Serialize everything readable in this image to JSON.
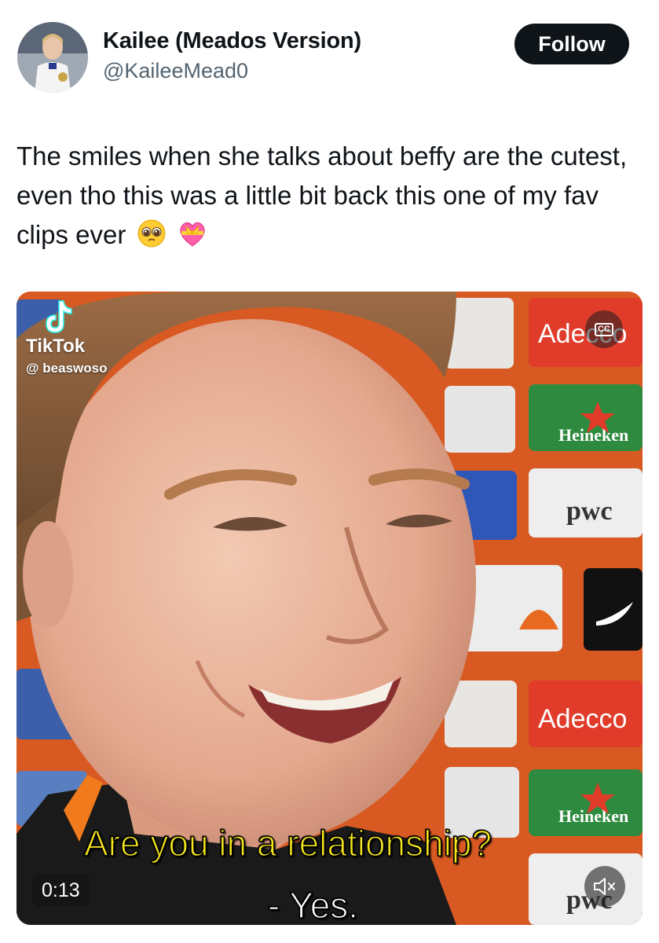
{
  "author": {
    "display_name": "Kailee (Meados Version)",
    "handle": "@KaileeMead0",
    "avatar_icon": "profile-avatar"
  },
  "follow_label": "Follow",
  "tweet": {
    "text": "The smiles when she talks about beffy are the cutest, even tho this was a little bit back this one of my fav clips ever",
    "emojis": [
      "pleading-face-emoji",
      "heart-with-ribbon-emoji"
    ]
  },
  "video": {
    "watermark_app": "TikTok",
    "watermark_user": "@ beaswoso",
    "caption_line1": "Are you in a relationship?",
    "caption_line2": "- Yes.",
    "duration": "0:13",
    "cc_label": "CC",
    "background_labels": [
      "Adecco",
      "Heineken",
      "pwc",
      "Adecco",
      "Heineken",
      "pwc"
    ]
  },
  "colors": {
    "follow_bg": "#0f1419",
    "text": "#0f1419",
    "secondary_text": "#536471",
    "caption_yellow": "#f5e61c",
    "board_orange": "#d85a22"
  }
}
